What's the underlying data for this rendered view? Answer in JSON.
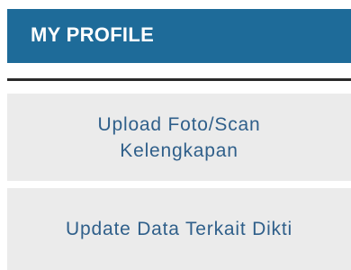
{
  "profile_panel": {
    "title": "MY PROFILE",
    "items": [
      {
        "label": "Upload Foto/Scan Kelengkapan"
      },
      {
        "label": "Update Data Terkait Dikti"
      }
    ]
  },
  "colors": {
    "header_background": "#1e6b99",
    "header_text": "#ffffff",
    "item_background": "#ebebeb",
    "item_text": "#2f5f8a",
    "divider": "#2a2a2a"
  }
}
